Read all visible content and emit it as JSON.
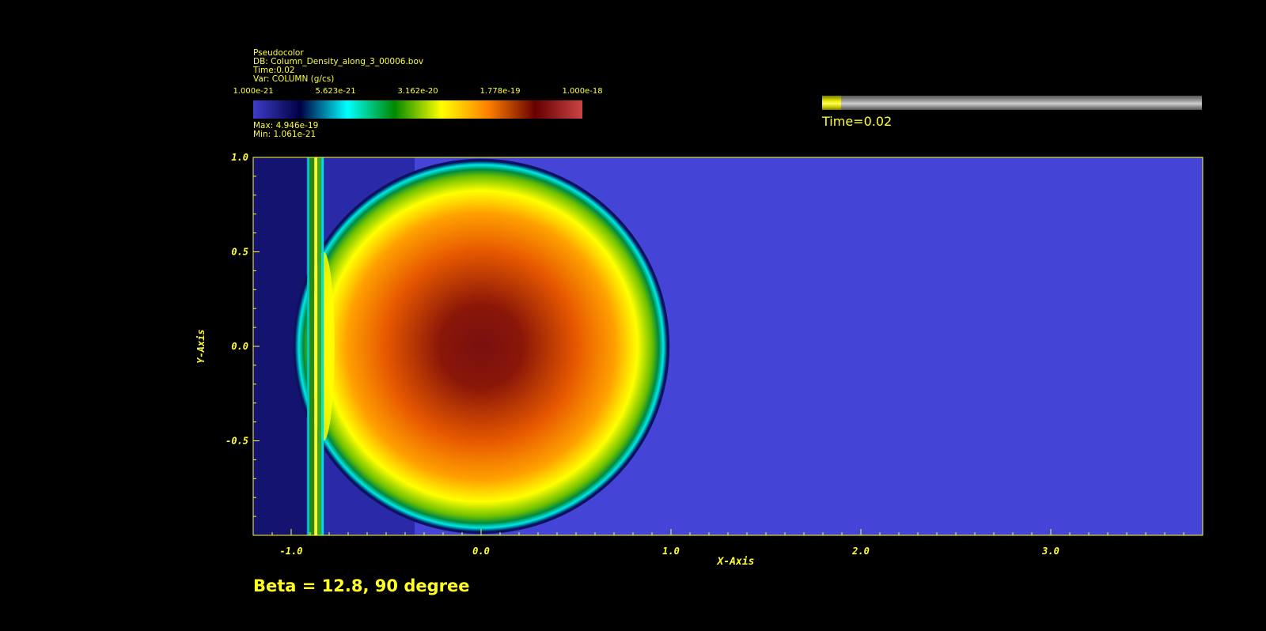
{
  "legend": {
    "plot_type": "Pseudocolor",
    "db": "DB: Column_Density_along_3_00006.bov",
    "time": "Time:0.02",
    "var": "Var: COLUMN (g/cs)",
    "max": "Max:  4.946e-19",
    "min": "Min:  1.061e-21",
    "ticks": [
      "1.000e-21",
      "5.623e-21",
      "3.162e-20",
      "1.778e-19",
      "1.000e-18"
    ],
    "colormap": [
      "#3d3dc8",
      "#000044",
      "#00ffff",
      "#008800",
      "#ffff00",
      "#ff8000",
      "#660000",
      "#cc4444"
    ]
  },
  "time_slider": {
    "label": "Time=0.02",
    "progress": 0.05
  },
  "caption": "Beta = 12.8, 90 degree",
  "colors": {
    "annotation": "#ffff33",
    "background": "#000000",
    "field": "#4444d6"
  },
  "chart_data": {
    "type": "heatmap",
    "xlabel": "X-Axis",
    "ylabel": "Y-Axis",
    "xlim": [
      -1.2,
      3.8
    ],
    "ylim": [
      -1.0,
      1.0
    ],
    "x_ticks": [
      "-1.0",
      "0.0",
      "1.0",
      "2.0",
      "3.0"
    ],
    "y_ticks": [
      "1.0",
      "0.5",
      "0.0",
      "-0.5"
    ],
    "features": {
      "cloud_center": [
        0.0,
        0.0
      ],
      "cloud_radius": 0.98,
      "shock_x": -0.87,
      "upstream_x_range": [
        -1.2,
        -0.35
      ]
    }
  }
}
